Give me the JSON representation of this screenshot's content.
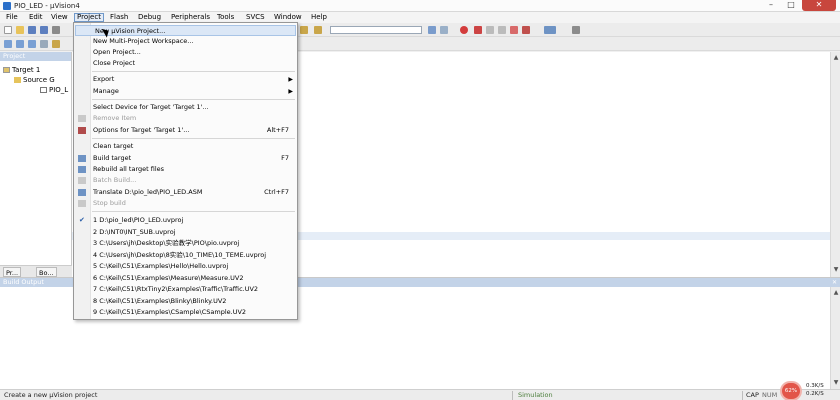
{
  "window": {
    "title": "PIO_LED - µVision4",
    "minimize": "–",
    "maximize": "□",
    "close": "✕"
  },
  "menubar": [
    "File",
    "Edit",
    "View",
    "Project",
    "Flash",
    "Debug",
    "Peripherals",
    "Tools",
    "SVCS",
    "Window",
    "Help"
  ],
  "project_panel": {
    "title": "Project",
    "tree": [
      "Target 1",
      "Source G",
      "PIO_L"
    ],
    "tabs": [
      "Pr...",
      "Bo..."
    ]
  },
  "project_menu": {
    "items": [
      {
        "label": "New µVision Project...",
        "highlighted": true
      },
      {
        "label": "New Multi-Project Workspace..."
      },
      {
        "label": "Open Project..."
      },
      {
        "label": "Close Project"
      },
      {
        "label": "Export",
        "submenu": true
      },
      {
        "label": "Manage",
        "submenu": true
      },
      {
        "label": "Select Device for Target 'Target 1'..."
      },
      {
        "label": "Remove Item",
        "disabled": true
      },
      {
        "label": "Options for Target 'Target 1'...",
        "shortcut": "Alt+F7"
      },
      {
        "label": "Clean target"
      },
      {
        "label": "Build target",
        "shortcut": "F7"
      },
      {
        "label": "Rebuild all target files"
      },
      {
        "label": "Batch Build...",
        "disabled": true
      },
      {
        "label": "Translate D:\\pio_led\\PIO_LED.ASM",
        "shortcut": "Ctrl+F7"
      },
      {
        "label": "Stop build",
        "disabled": true
      },
      {
        "label": "1 D:\\pio_led\\PIO_LED.uvproj",
        "checked": true
      },
      {
        "label": "2 D:\\INT0\\INT_SUB.uvproj"
      },
      {
        "label": "3 C:\\Users\\jh\\Desktop\\实验教学\\PIO\\pio.uvproj"
      },
      {
        "label": "4 C:\\Users\\jh\\Desktop\\8实验\\10_TIME\\10_TEME.uvproj"
      },
      {
        "label": "5 C:\\Keil\\C51\\Examples\\Hello\\Hello.uvproj"
      },
      {
        "label": "6 C:\\Keil\\C51\\Examples\\Measure\\Measure.UV2"
      },
      {
        "label": "7 C:\\Keil\\C51\\RtxTiny2\\Examples\\Traffic\\Traffic.UV2"
      },
      {
        "label": "8 C:\\Keil\\C51\\Examples\\Blinky\\Blinky.UV2"
      },
      {
        "label": "9 C:\\Keil\\C51\\Examples\\CSample\\CSample.UV2"
      }
    ]
  },
  "build_output": {
    "title": "Build Output"
  },
  "status": {
    "message": "Create a new µVision project",
    "mode": "Simulation",
    "cap": "CAP",
    "num": "NUM",
    "cpu": "62%",
    "net_up": "0.3K/S",
    "net_down": "0.2K/S"
  }
}
